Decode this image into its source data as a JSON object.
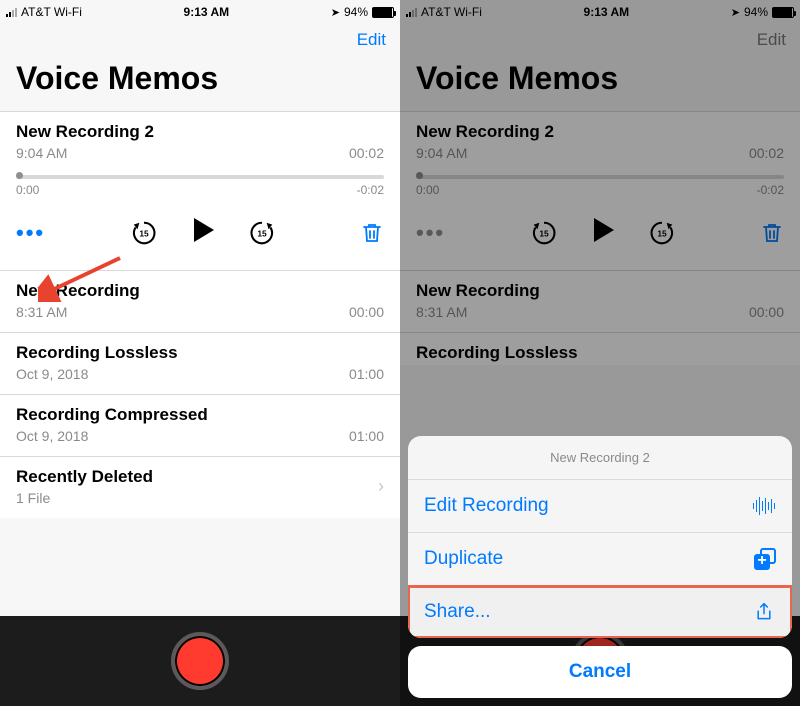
{
  "status": {
    "carrier": "AT&T Wi-Fi",
    "time": "9:13 AM",
    "battery_pct": "94%",
    "location_glyph": "➤"
  },
  "nav": {
    "edit": "Edit"
  },
  "title": "Voice Memos",
  "expanded": {
    "title": "New Recording 2",
    "subtitle": "9:04 AM",
    "duration": "00:02",
    "t_start": "0:00",
    "t_end": "-0:02",
    "skip_amount": "15"
  },
  "rows": [
    {
      "title": "New Recording",
      "subtitle": "8:31 AM",
      "duration": "00:00"
    },
    {
      "title": "Recording Lossless",
      "subtitle": "Oct 9, 2018",
      "duration": "01:00"
    },
    {
      "title": "Recording Compressed",
      "subtitle": "Oct 9, 2018",
      "duration": "01:00"
    }
  ],
  "deleted": {
    "title": "Recently Deleted",
    "subtitle": "1 File"
  },
  "sheet": {
    "header": "New Recording 2",
    "edit": "Edit Recording",
    "duplicate": "Duplicate",
    "share": "Share...",
    "cancel": "Cancel"
  },
  "right_extra_row_title": "Recording Lossless"
}
